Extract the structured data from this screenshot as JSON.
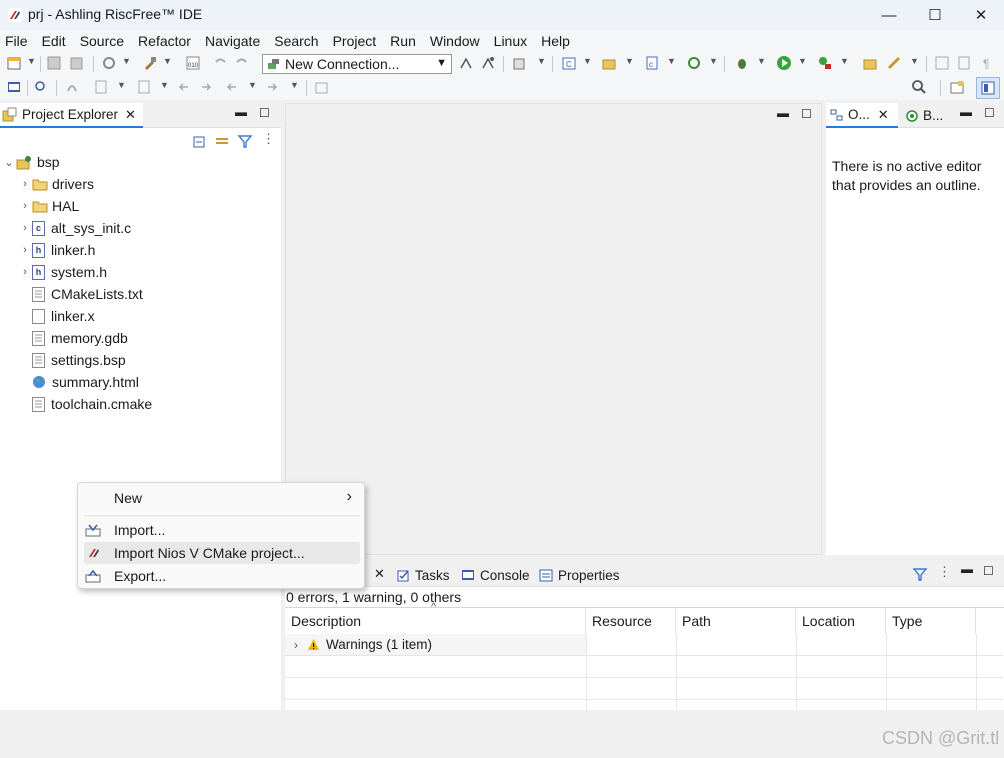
{
  "window": {
    "title": "prj - Ashling RiscFree™ IDE",
    "minimize": "—",
    "maximize": "☐",
    "close": "✕"
  },
  "menu": [
    "File",
    "Edit",
    "Source",
    "Refactor",
    "Navigate",
    "Search",
    "Project",
    "Run",
    "Window",
    "Linux",
    "Help"
  ],
  "toolbar": {
    "connection_value": "New Connection..."
  },
  "project_explorer": {
    "tab_label": "Project Explorer",
    "tree": [
      {
        "label": "bsp",
        "icon": "project-icon",
        "expander": "expanded",
        "level": 0
      },
      {
        "label": "drivers",
        "icon": "folder-icon",
        "expander": "collapsed",
        "level": 1
      },
      {
        "label": "HAL",
        "icon": "folder-icon",
        "expander": "collapsed",
        "level": 1
      },
      {
        "label": "alt_sys_init.c",
        "icon": "c-file-icon",
        "expander": "collapsed",
        "level": 1
      },
      {
        "label": "linker.h",
        "icon": "h-file-icon",
        "expander": "collapsed",
        "level": 1
      },
      {
        "label": "system.h",
        "icon": "h-file-icon",
        "expander": "collapsed",
        "level": 1
      },
      {
        "label": "CMakeLists.txt",
        "icon": "text-file-icon",
        "expander": "none",
        "level": 1
      },
      {
        "label": "linker.x",
        "icon": "file-icon",
        "expander": "none",
        "level": 1
      },
      {
        "label": "memory.gdb",
        "icon": "text-file-icon",
        "expander": "none",
        "level": 1
      },
      {
        "label": "settings.bsp",
        "icon": "text-file-icon",
        "expander": "none",
        "level": 1
      },
      {
        "label": "summary.html",
        "icon": "globe-icon",
        "expander": "none",
        "level": 1
      },
      {
        "label": "toolchain.cmake",
        "icon": "text-file-icon",
        "expander": "none",
        "level": 1
      }
    ]
  },
  "outline": {
    "tab1": "O...",
    "tab2": "B...",
    "message": "There is no active editor that provides an outline."
  },
  "context_menu": {
    "items": [
      {
        "label": "New",
        "has_submenu": true,
        "icon": ""
      },
      {
        "label": "Import...",
        "has_submenu": false,
        "icon": "import-icon"
      },
      {
        "label": "Import Nios V CMake project...",
        "has_submenu": false,
        "icon": "nios-import-icon",
        "highlighted": true
      },
      {
        "label": "Export...",
        "has_submenu": false,
        "icon": "export-icon"
      }
    ],
    "submenu_arrow": "›"
  },
  "bottom_panel": {
    "tabs": [
      "Tasks",
      "Console",
      "Properties"
    ],
    "summary": "0 errors, 1 warning, 0 others",
    "columns": [
      "Description",
      "Resource",
      "Path",
      "Location",
      "Type"
    ],
    "rows": [
      {
        "description": "Warnings (1 item)"
      }
    ]
  },
  "watermark": "CSDN @Grit.tl",
  "colors": {
    "accent": "#2979d6",
    "folder": "#e7c45c",
    "warning": "#f0b400"
  }
}
